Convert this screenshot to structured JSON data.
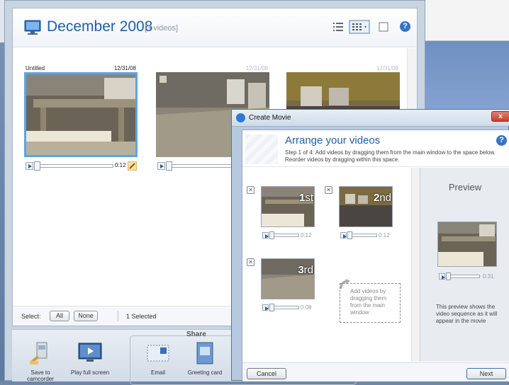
{
  "main": {
    "title": "December 2008",
    "video_count": "[3 videos]",
    "help": "?",
    "thumbnails": [
      {
        "name": "Untitled",
        "date": "12/31/08",
        "duration": "0:12"
      },
      {
        "name": "",
        "date": "12/31/08",
        "duration": ""
      },
      {
        "name": "",
        "date": "12/31/08",
        "duration": ""
      }
    ],
    "footer": {
      "select_label": "Select:",
      "all_label": "All",
      "none_label": "None",
      "selected_count": "1 Selected"
    }
  },
  "share": {
    "label": "Share",
    "items": [
      {
        "label": "Save to camcorder"
      },
      {
        "label": "Play full screen"
      },
      {
        "label": "Email"
      },
      {
        "label": "Greeting card"
      }
    ]
  },
  "dialog": {
    "title": "Create Movie",
    "close": "x",
    "heading": "Arrange your videos",
    "step_text": "Step 1 of 4: Add videos by dragging them from the main window to the space below. Reorder videos by dragging within this space.",
    "help": "?",
    "slots": [
      {
        "order_num": "1",
        "order_suffix": "st",
        "duration": "0:12"
      },
      {
        "order_num": "2",
        "order_suffix": "nd",
        "duration": "0:12"
      },
      {
        "order_num": "3",
        "order_suffix": "rd",
        "duration": "0:08"
      }
    ],
    "drop_hint": "Add videos by dragging them from the main window",
    "preview": {
      "title": "Preview",
      "duration": "0:31",
      "note": "This preview shows the video sequence as it will appear in the movie"
    },
    "cancel_label": "Cancel",
    "next_label": "Next"
  }
}
